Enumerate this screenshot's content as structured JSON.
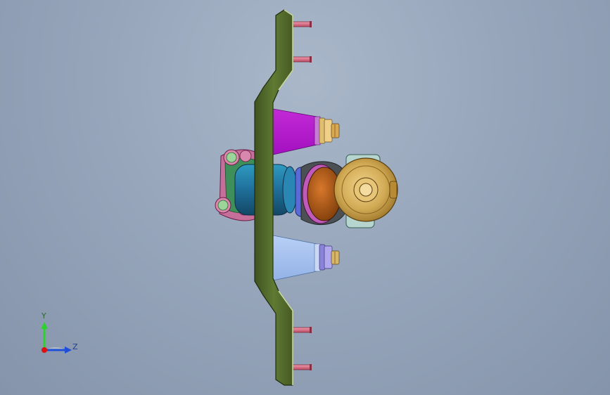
{
  "viewport": {
    "background_top": "#a9b7c9",
    "background_bottom": "#8594aa"
  },
  "triad": {
    "y_label": "Y",
    "z_label": "Z",
    "y_color": "#2fd12f",
    "z_color": "#1f4fd8",
    "x_color": "#e01010"
  },
  "model": {
    "parts": [
      "mounting-plate",
      "mounting-studs",
      "magenta-cone-bracket",
      "lightblue-cone-bracket",
      "brass-nut-top",
      "bolt-nut-bottom",
      "pipe-clamp",
      "teal-cylinder",
      "orange-elbow",
      "bronze-valve-head",
      "pale-valve-body"
    ],
    "colors": {
      "plate": "#556b2f",
      "plate_edge": "#c8d7a0",
      "stud": "#e07a8f",
      "magenta": "#c21cd6",
      "lightblue": "#a8c4f0",
      "brass": "#d9b25a",
      "clamp": "#e26a8e",
      "teal": "#1f6f9a",
      "orange": "#b85a14",
      "bronze": "#c9a04a",
      "pale": "#b6d5cf"
    }
  }
}
